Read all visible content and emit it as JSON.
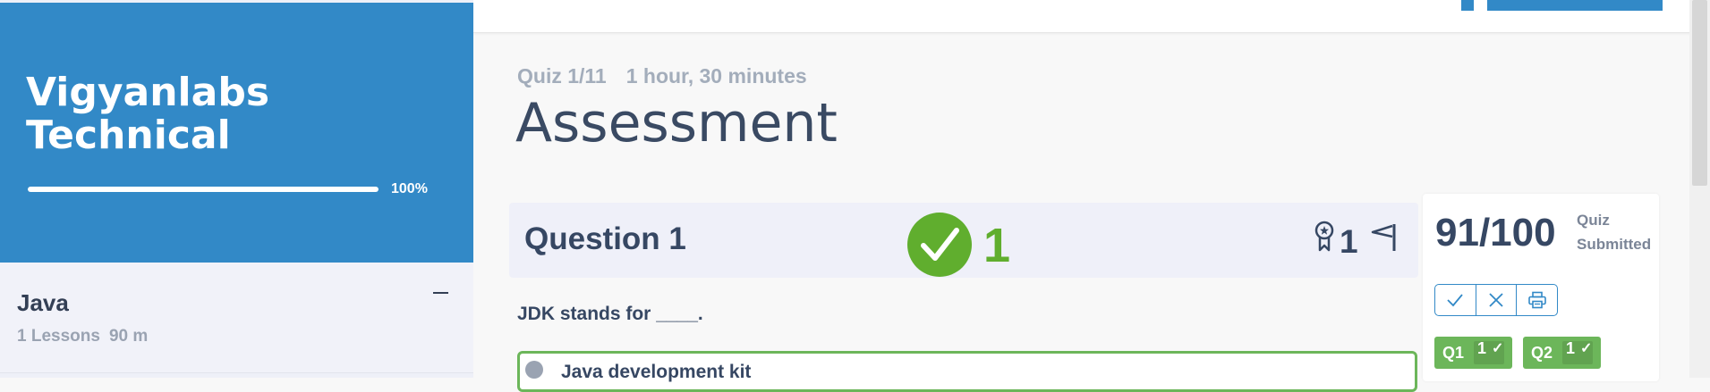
{
  "course": {
    "title": "Vigyanlabs Technical",
    "progress_label": "100%",
    "progress_percent": 100,
    "accent_color": "#3289c7"
  },
  "section": {
    "title": "Java",
    "lessons": "1 Lessons",
    "duration": "90 m",
    "collapse_icon": "minus-icon"
  },
  "quiz": {
    "position": "Quiz 1/11",
    "duration": "1 hour, 30 minutes",
    "title": "Assessment"
  },
  "question": {
    "title": "Question 1",
    "result_icon": "check-circle-icon",
    "score": "1",
    "points": "1",
    "text": "JDK stands for ____.",
    "options": [
      {
        "label": "Java development kit",
        "selected": true
      }
    ],
    "success_color": "#60ae2e"
  },
  "result": {
    "score": "91/100",
    "status": "Quiz Submitted",
    "tools": [
      "check-icon",
      "close-icon",
      "print-icon"
    ],
    "questions": [
      {
        "label": "Q1",
        "points": "1",
        "icon": "check-icon"
      },
      {
        "label": "Q2",
        "points": "1",
        "icon": "check-icon"
      }
    ]
  }
}
